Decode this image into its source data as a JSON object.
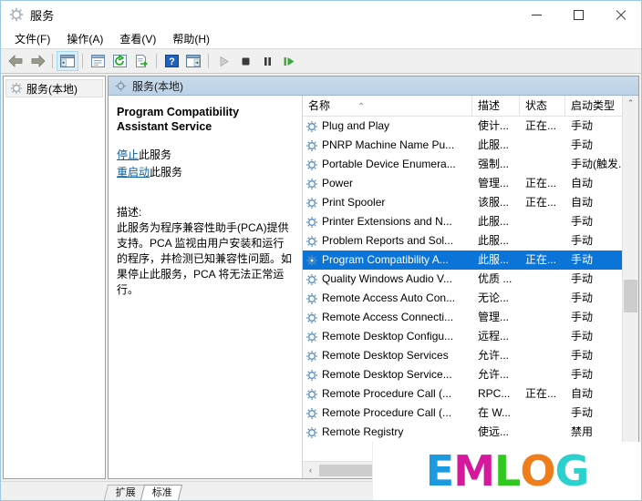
{
  "window": {
    "title": "服务",
    "title_icon": "gear-icon",
    "minimize_label": "最小化",
    "maximize_label": "最大化",
    "close_label": "关闭"
  },
  "menubar": {
    "items": [
      {
        "label": "文件(F)"
      },
      {
        "label": "操作(A)"
      },
      {
        "label": "查看(V)"
      },
      {
        "label": "帮助(H)"
      }
    ]
  },
  "toolbar": {
    "buttons": [
      {
        "name": "back-icon",
        "glyph": "◄",
        "pressed": false
      },
      {
        "name": "forward-icon",
        "glyph": "►",
        "pressed": false
      },
      {
        "name": "show-hide-tree-icon",
        "glyph": "▤",
        "pressed": true
      },
      {
        "name": "properties-icon",
        "glyph": "▤",
        "pressed": false
      },
      {
        "name": "refresh-icon",
        "glyph": "⟳",
        "pressed": false
      },
      {
        "name": "export-list-icon",
        "glyph": "⇥",
        "pressed": false
      },
      {
        "name": "help-icon",
        "glyph": "?",
        "pressed": false
      },
      {
        "name": "show-action-pane-icon",
        "glyph": "▤",
        "pressed": false
      },
      {
        "name": "start-service-icon",
        "glyph": "▶",
        "pressed": false
      },
      {
        "name": "stop-service-icon",
        "glyph": "■",
        "pressed": false
      },
      {
        "name": "pause-service-icon",
        "glyph": "❚❚",
        "pressed": false
      },
      {
        "name": "restart-service-icon",
        "glyph": "▶|",
        "pressed": false
      }
    ]
  },
  "tree": {
    "items": [
      {
        "label": "服务(本地)",
        "icon": "gear-icon",
        "selected": true
      }
    ]
  },
  "result_header": {
    "icon": "gear-icon",
    "label": "服务(本地)"
  },
  "detail": {
    "service_title": "Program Compatibility Assistant Service",
    "links": [
      {
        "link_text": "停止",
        "suffix": "此服务"
      },
      {
        "link_text": "重启动",
        "suffix": "此服务"
      }
    ],
    "description_label": "描述:",
    "description_text": "此服务为程序兼容性助手(PCA)提供支持。PCA 监视由用户安装和运行的程序，并检测已知兼容性问题。如果停止此服务，PCA 将无法正常运行。"
  },
  "list": {
    "columns": [
      {
        "key": "name",
        "label": "名称",
        "sorted": true,
        "sort_glyph": "⌃"
      },
      {
        "key": "description",
        "label": "描述"
      },
      {
        "key": "status",
        "label": "状态"
      },
      {
        "key": "startup",
        "label": "启动类型"
      }
    ],
    "rows": [
      {
        "name": "Plug and Play",
        "description": "使计...",
        "status": "正在...",
        "startup": "手动",
        "selected": false
      },
      {
        "name": "PNRP Machine Name Pu...",
        "description": "此服...",
        "status": "",
        "startup": "手动",
        "selected": false
      },
      {
        "name": "Portable Device Enumera...",
        "description": "强制...",
        "status": "",
        "startup": "手动(触发...",
        "selected": false
      },
      {
        "name": "Power",
        "description": "管理...",
        "status": "正在...",
        "startup": "自动",
        "selected": false
      },
      {
        "name": "Print Spooler",
        "description": "该服...",
        "status": "正在...",
        "startup": "自动",
        "selected": false
      },
      {
        "name": "Printer Extensions and N...",
        "description": "此服...",
        "status": "",
        "startup": "手动",
        "selected": false
      },
      {
        "name": "Problem Reports and Sol...",
        "description": "此服...",
        "status": "",
        "startup": "手动",
        "selected": false
      },
      {
        "name": "Program Compatibility A...",
        "description": "此服...",
        "status": "正在...",
        "startup": "手动",
        "selected": true
      },
      {
        "name": "Quality Windows Audio V...",
        "description": "优质 ...",
        "status": "",
        "startup": "手动",
        "selected": false
      },
      {
        "name": "Remote Access Auto Con...",
        "description": "无论...",
        "status": "",
        "startup": "手动",
        "selected": false
      },
      {
        "name": "Remote Access Connecti...",
        "description": "管理...",
        "status": "",
        "startup": "手动",
        "selected": false
      },
      {
        "name": "Remote Desktop Configu...",
        "description": "远程...",
        "status": "",
        "startup": "手动",
        "selected": false
      },
      {
        "name": "Remote Desktop Services",
        "description": "允许...",
        "status": "",
        "startup": "手动",
        "selected": false
      },
      {
        "name": "Remote Desktop Service...",
        "description": "允许...",
        "status": "",
        "startup": "手动",
        "selected": false
      },
      {
        "name": "Remote Procedure Call (...",
        "description": "RPC...",
        "status": "正在...",
        "startup": "自动",
        "selected": false
      },
      {
        "name": "Remote Procedure Call (...",
        "description": "在 W...",
        "status": "",
        "startup": "手动",
        "selected": false
      },
      {
        "name": "Remote Registry",
        "description": "使远...",
        "status": "",
        "startup": "禁用",
        "selected": false
      }
    ]
  },
  "scrollbars": {
    "vertical_up_glyph": "⌃",
    "vertical_down_glyph": "⌄",
    "horizontal_left_glyph": "‹"
  },
  "tabs": [
    {
      "label": "扩展",
      "active": false
    },
    {
      "label": "标准",
      "active": true
    }
  ],
  "watermark": {
    "letters": [
      {
        "char": "E",
        "color": "#1b9ae0"
      },
      {
        "char": "M",
        "color": "#d6189e"
      },
      {
        "char": "L",
        "color": "#2ec81e"
      },
      {
        "char": "O",
        "color": "#ef7d1c"
      },
      {
        "char": "G",
        "color": "#2bd2cd"
      }
    ]
  }
}
